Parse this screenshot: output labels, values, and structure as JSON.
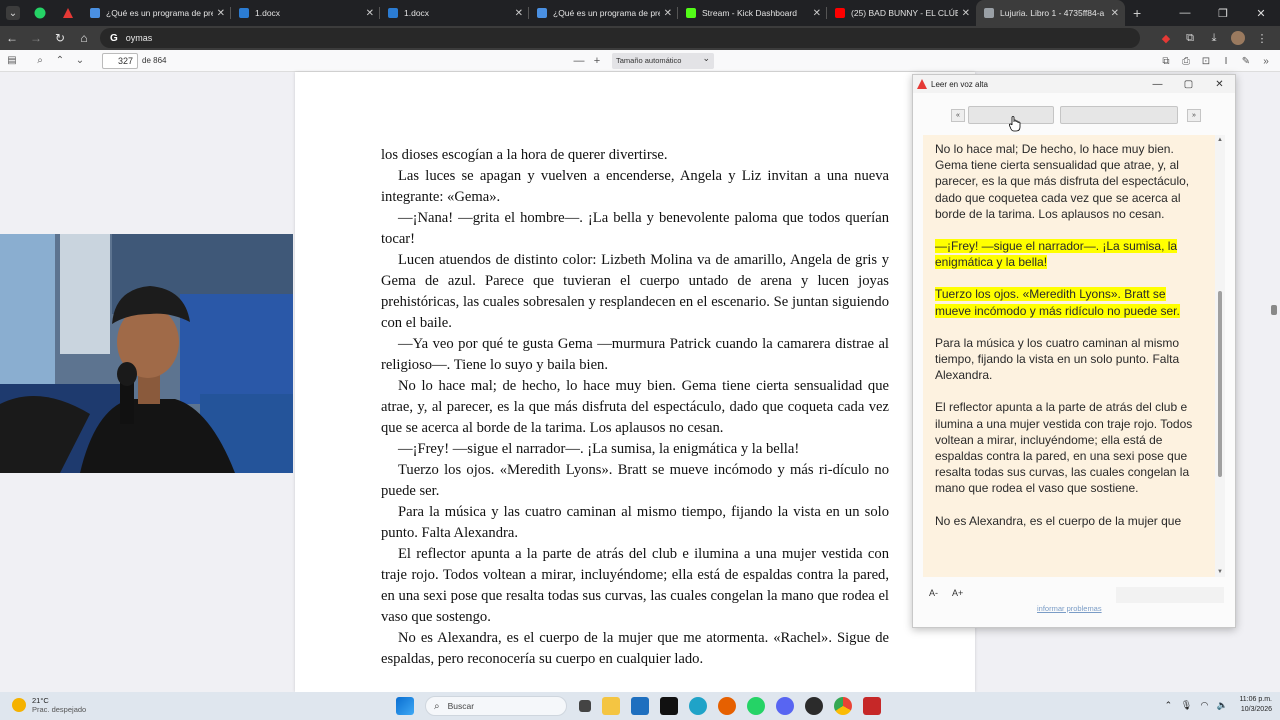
{
  "browser": {
    "tabs": [
      {
        "label": "¿Qué es un programa de pre",
        "color": "#4a90e2",
        "active": false
      },
      {
        "label": "1.docx",
        "color": "#2b7cd3",
        "active": false
      },
      {
        "label": "1.docx",
        "color": "#2b7cd3",
        "active": false
      },
      {
        "label": "¿Qué es un programa de pre",
        "color": "#4a90e2",
        "active": false
      },
      {
        "label": "Stream - Kick Dashboard",
        "color": "#53fc18",
        "active": false
      },
      {
        "label": "(25) BAD BUNNY - EL CLÚB",
        "color": "#ff0000",
        "active": false
      },
      {
        "label": "Lujuria. Libro 1 - 4735ff84-a",
        "color": "#9aa0a6",
        "active": true
      }
    ],
    "address": "oymas",
    "omnibox_icon": "G"
  },
  "pdf": {
    "page_number": "327",
    "page_total": "de 864",
    "zoom": "Tamaño automático",
    "paragraphs": [
      {
        "text": "los dioses escogían a la hora de querer divertirse.",
        "indent": false
      },
      {
        "text": "Las luces se apagan y vuelven a encenderse, Angela y Liz invitan a una nueva integrante: «Gema».",
        "indent": true
      },
      {
        "text": "—¡Nana! —grita el hombre—. ¡La bella y benevolente paloma que todos querían tocar!",
        "indent": true
      },
      {
        "text": "Lucen atuendos de distinto color: Lizbeth Molina va de amarillo, Angela de gris y Gema de azul. Parece que tuvieran el cuerpo untado de arena y lucen joyas prehistóricas, las cuales sobresalen y resplandecen en el escenario. Se juntan siguiendo con el baile.",
        "indent": true
      },
      {
        "text": "—Ya veo por qué te gusta Gema —murmura Patrick cuando la camarera distrae al religioso—. Tiene lo suyo y baila bien.",
        "indent": true
      },
      {
        "text": "No lo hace mal; de hecho, lo hace muy bien. Gema tiene cierta sensualidad que atrae, y, al parecer, es la que más disfruta del espectáculo, dado que coqueta cada vez que se acerca al borde de la tarima. Los aplausos no cesan.",
        "indent": true
      },
      {
        "text": "—¡Frey! —sigue el narrador—. ¡La sumisa, la enigmática y la bella!",
        "indent": true
      },
      {
        "text": "Tuerzo los ojos. «Meredith Lyons». Bratt se mueve incómodo y más ri-dículo no puede ser.",
        "indent": true
      },
      {
        "text": "Para la música y las cuatro caminan al mismo tiempo, fijando la vista en un solo punto. Falta Alexandra.",
        "indent": true
      },
      {
        "text": "El reflector apunta a la parte de atrás del club e ilumina a una mujer vestida con traje rojo. Todos voltean a mirar, incluyéndome; ella está de espaldas contra la pared, en una sexi pose que resalta todas sus curvas, las cuales congelan la mano que rodea el vaso que sostengo.",
        "indent": true
      },
      {
        "text": "No es Alexandra, es el cuerpo de la mujer que me atormenta. «Rachel». Sigue de espaldas, pero reconocería su cuerpo en cualquier lado.",
        "indent": true
      }
    ]
  },
  "read_aloud": {
    "title": "Leer en voz alta",
    "prev_label": "«",
    "next_label": "»",
    "paragraphs": [
      {
        "text": "No lo hace mal; De hecho, lo hace muy bien. Gema tiene cierta sensualidad que atrae, y, al parecer, es la que más disfruta del espectáculo, dado que coquetea cada vez que se acerca al borde de la tarima. Los aplausos no cesan.",
        "highlight": false
      },
      {
        "text": "—¡Frey! —sigue el narrador—. ¡La sumisa, la enigmática y la bella!",
        "highlight": true
      },
      {
        "text": "Tuerzo los ojos. «Meredith Lyons». Bratt se mueve incómodo y más ridículo no puede ser.",
        "highlight": true
      },
      {
        "text": "Para la música y los cuatro caminan al mismo tiempo, fijando la vista en un solo punto. Falta Alexandra.",
        "highlight": false
      },
      {
        "text": "El reflector apunta a la parte de atrás del club e ilumina a una mujer vestida con traje rojo. Todos voltean a mirar, incluyéndome; ella está de espaldas contra la pared, en una sexi pose que resalta todas sus curvas, las cuales congelan la mano que rodea el vaso que sostiene.",
        "highlight": false
      },
      {
        "text": "No es Alexandra, es el cuerpo de la mujer que",
        "highlight": false
      }
    ],
    "font_minus": "A-",
    "font_plus": "A+",
    "report_link": "informar problemas",
    "highlight_color": "#ffff00",
    "text_bg": "#fdf2e0"
  },
  "taskbar": {
    "temperature": "21°C",
    "weather_desc": "Prac. despejado",
    "search_placeholder": "Buscar",
    "time": "11:06 p.m.",
    "date": "10/3/2026"
  }
}
